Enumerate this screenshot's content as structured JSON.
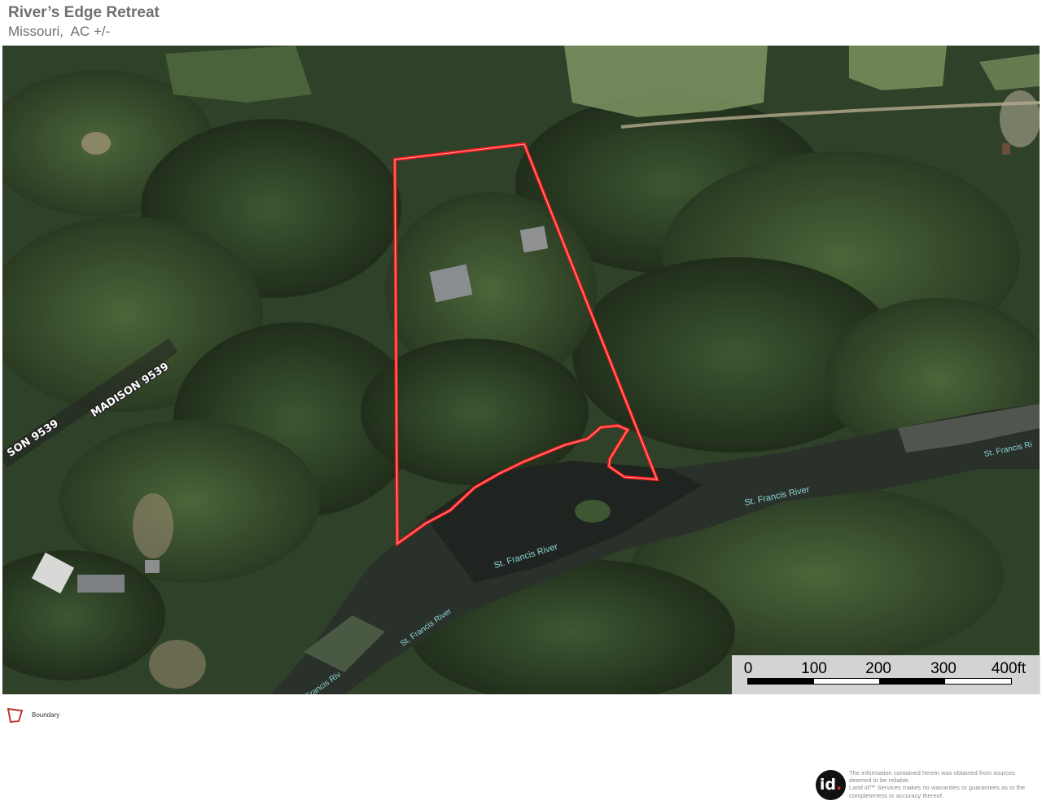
{
  "header": {
    "title": "River’s Edge Retreat",
    "subtitle": "Missouri,  AC +/-"
  },
  "map": {
    "roads": [
      {
        "label": "MADISON 9539"
      },
      {
        "label": "SON 9539"
      }
    ],
    "rivers": [
      {
        "label": "St. Francis River"
      },
      {
        "label": "St. Francis River"
      },
      {
        "label": "St. Francis River"
      },
      {
        "label": "St. Francis Riv"
      },
      {
        "label": "St. Francis Ri"
      }
    ],
    "boundary_color": "#ff1a1a"
  },
  "scale": {
    "labels": [
      "0",
      "100",
      "200",
      "300",
      "400ft"
    ]
  },
  "legend": {
    "items": [
      {
        "label": "Boundary",
        "icon": "boundary-polygon-icon",
        "color": "#c0392b"
      }
    ]
  },
  "footer": {
    "logo_text": "id",
    "logo_dot": ".",
    "disclaimer_lines": [
      "The information contained herein was obtained from sources",
      "deemed to be reliable.",
      "Land id™ Services makes no warranties or guarantees as to the",
      "completeness or accuracy thereof."
    ]
  }
}
